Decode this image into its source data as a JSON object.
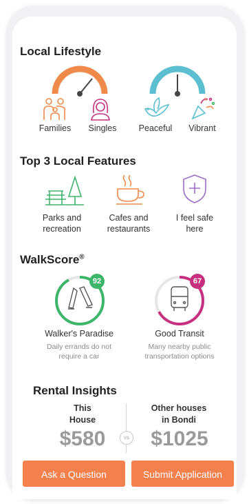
{
  "lifestyle": {
    "title": "Local Lifestyle",
    "families_label": "Families",
    "singles_label": "Singles",
    "peaceful_label": "Peaceful",
    "vibrant_label": "Vibrant",
    "gauge1_color": "#f08a4b",
    "gauge2_color": "#5bbfd1"
  },
  "features": {
    "title": "Top 3 Local Features",
    "items": [
      {
        "line1": "Parks and",
        "line2": "recreation",
        "icon": "park-bench-tree-icon",
        "color": "#3db56b"
      },
      {
        "line1": "Cafes and",
        "line2": "restaurants",
        "icon": "coffee-cup-icon",
        "color": "#f08a4b"
      },
      {
        "line1": "I feel safe",
        "line2": "here",
        "icon": "shield-plus-icon",
        "color": "#9b6cc7"
      }
    ]
  },
  "walkscore": {
    "title": "WalkScore",
    "trademark": "®",
    "walk": {
      "score": "92",
      "title": "Walker's Paradise",
      "desc1": "Daily errands do not",
      "desc2": "require a car",
      "color": "#3db56b"
    },
    "transit": {
      "score": "67",
      "title": "Good Transit",
      "desc1": "Many nearby public",
      "desc2": "transportation options",
      "color": "#c6307f"
    }
  },
  "rental": {
    "title": "Rental Insights",
    "this_line1": "This",
    "this_line2": "House",
    "this_price": "$580",
    "other_line1": "Other houses",
    "other_line2": "in Bondi",
    "other_price": "$1025",
    "vs": "vs"
  },
  "actions": {
    "ask": "Ask a Question",
    "submit": "Submit Application"
  }
}
